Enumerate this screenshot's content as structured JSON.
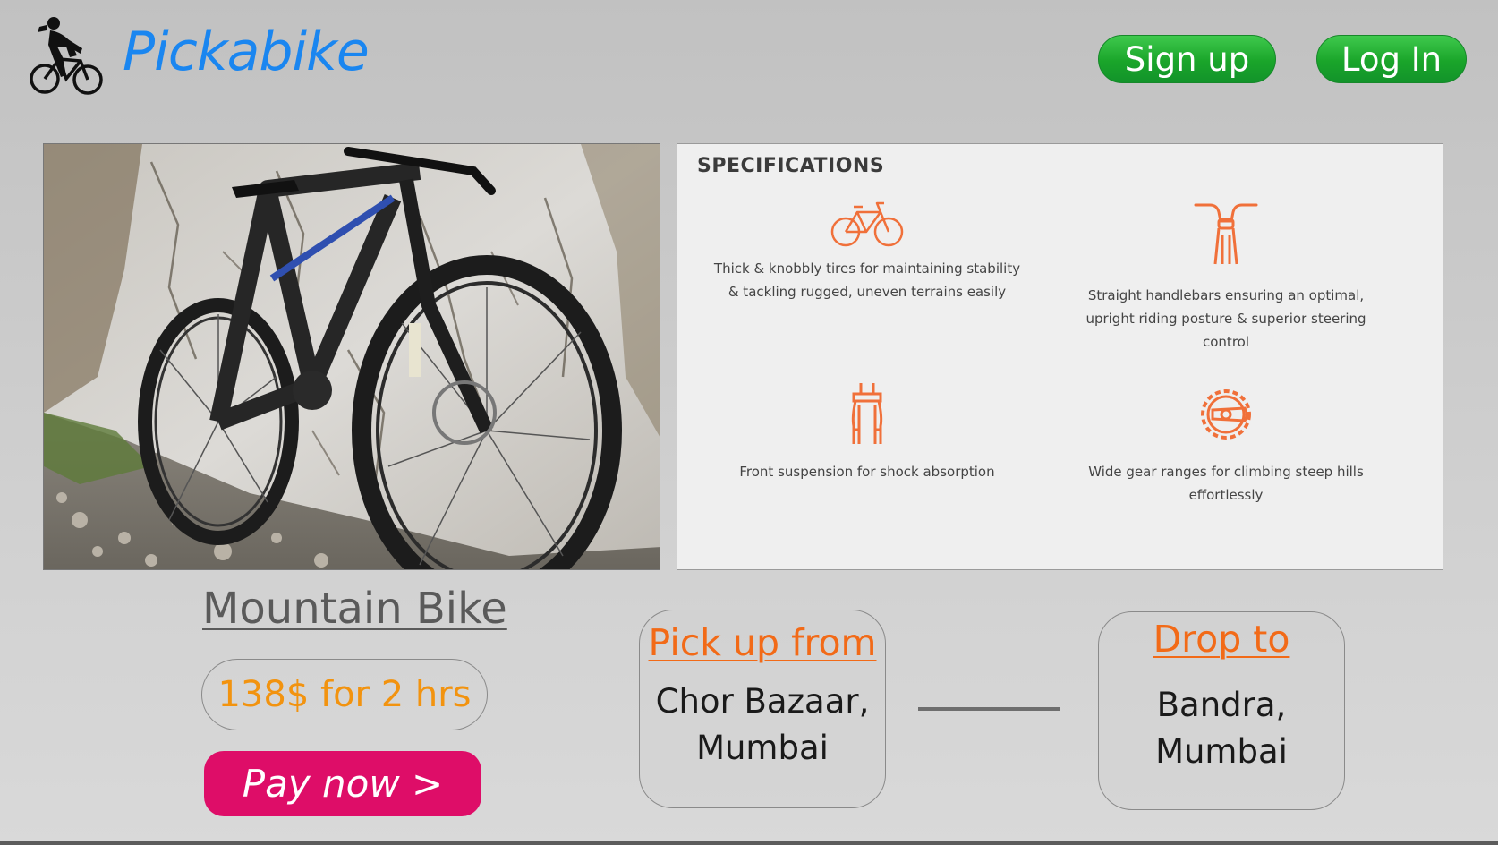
{
  "header": {
    "brand_name": "Pickabike",
    "logo_icon": "cyclist-icon",
    "brand_color": "#1a86f0",
    "signup_label": "Sign up",
    "login_label": "Log In",
    "button_color": "#1aa52a"
  },
  "product": {
    "image_icon": "mountain-bike-photo",
    "name": "Mountain Bike",
    "price": "138$ for 2 hrs",
    "pay_label": "Pay now >",
    "pay_color": "#de0d68",
    "price_color": "#f2930f"
  },
  "specs": {
    "title": "SPECIFICATIONS",
    "accent_color": "#f0703a",
    "items": [
      {
        "icon": "bicycle-icon",
        "text_lines": [
          "Thick & knobbly tires for maintaining stability",
          "& tackling rugged, uneven terrains easily"
        ]
      },
      {
        "icon": "handlebar-icon",
        "text_lines": [
          "Straight handlebars ensuring an optimal,",
          "upright riding posture & superior steering",
          "control"
        ]
      },
      {
        "icon": "suspension-fork-icon",
        "text_lines": [
          "Front suspension for shock absorption"
        ]
      },
      {
        "icon": "gear-icon",
        "text_lines": [
          "Wide gear ranges for climbing steep hills",
          "effortlessly"
        ]
      }
    ]
  },
  "route": {
    "pickup_heading": "Pick up from",
    "pickup_line1": "Chor Bazaar,",
    "pickup_line2": "Mumbai",
    "drop_heading": "Drop to",
    "drop_line1": "Bandra,",
    "drop_line2": "Mumbai",
    "heading_color": "#f26a17"
  }
}
